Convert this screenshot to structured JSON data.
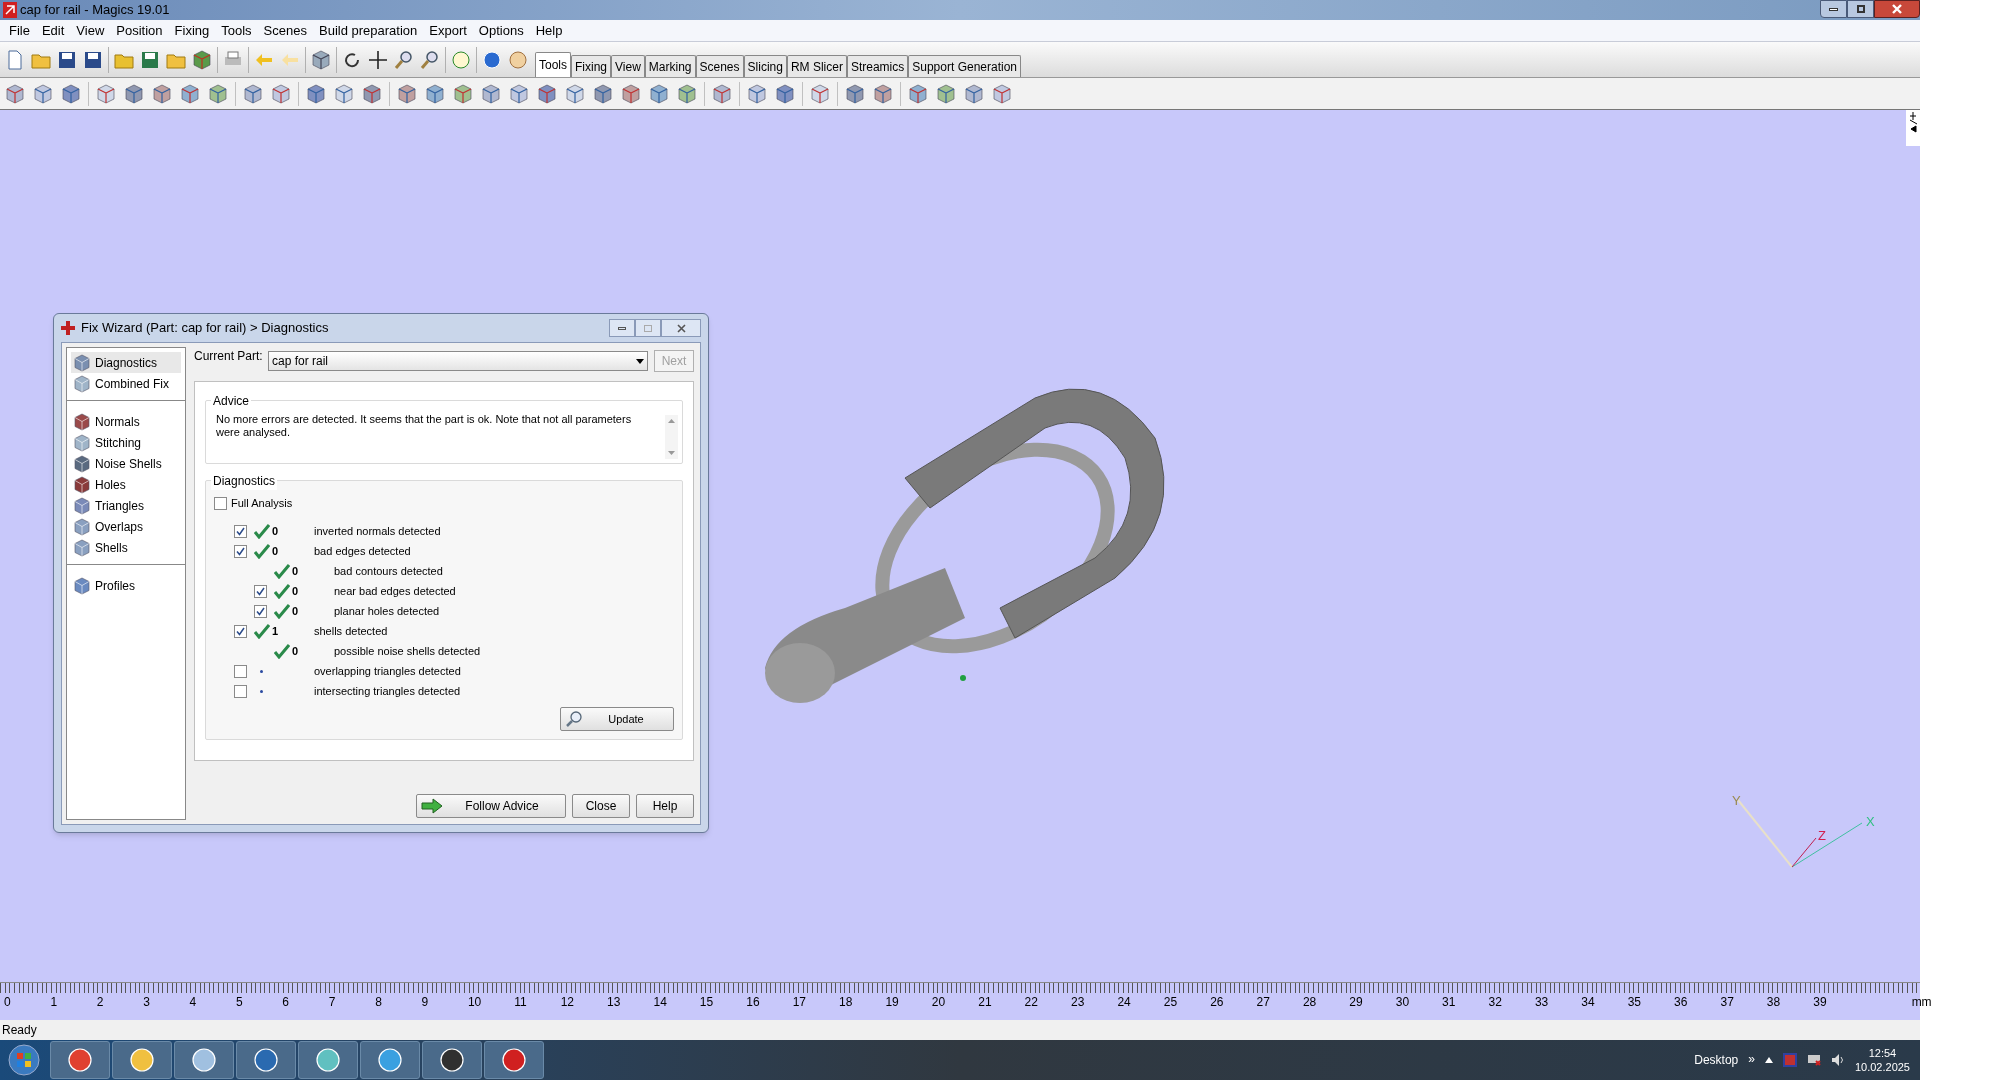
{
  "window": {
    "title": "cap for rail - Magics 19.01"
  },
  "menu": [
    "File",
    "Edit",
    "View",
    "Position",
    "Fixing",
    "Tools",
    "Scenes",
    "Build preparation",
    "Export",
    "Options",
    "Help"
  ],
  "toolbar_tabs": [
    {
      "label": "Tools",
      "selected": true
    },
    {
      "label": "Fixing",
      "selected": false
    },
    {
      "label": "View",
      "selected": false
    },
    {
      "label": "Marking",
      "selected": false
    },
    {
      "label": "Scenes",
      "selected": false
    },
    {
      "label": "Slicing",
      "selected": false
    },
    {
      "label": "RM Slicer",
      "selected": false
    },
    {
      "label": "Streamics",
      "selected": false
    },
    {
      "label": "Support Generation",
      "selected": false
    }
  ],
  "dialog": {
    "title": "Fix Wizard (Part: cap for rail) > Diagnostics",
    "nav_groups": [
      [
        {
          "label": "Diagnostics",
          "selected": true,
          "color": "#7a8fb0"
        },
        {
          "label": "Combined Fix",
          "selected": false,
          "color": "#9fb4c8"
        }
      ],
      [
        {
          "label": "Normals",
          "selected": false,
          "color": "#9a4a4a"
        },
        {
          "label": "Stitching",
          "selected": false,
          "color": "#9fb4c8"
        },
        {
          "label": "Noise Shells",
          "selected": false,
          "color": "#5a6a80"
        },
        {
          "label": "Holes",
          "selected": false,
          "color": "#8a3a3a"
        },
        {
          "label": "Triangles",
          "selected": false,
          "color": "#7a8ab8"
        },
        {
          "label": "Overlaps",
          "selected": false,
          "color": "#8aa0c0"
        },
        {
          "label": "Shells",
          "selected": false,
          "color": "#8aa0c0"
        }
      ],
      [
        {
          "label": "Profiles",
          "selected": false,
          "color": "#6a8ac0"
        }
      ]
    ],
    "current_part_label": "Current Part:",
    "current_part": "cap for rail",
    "next_button": {
      "label": "Next",
      "disabled": true
    },
    "advice": {
      "title": "Advice",
      "text": "No more errors are detected. It seems that the part is ok. Note that not all parameters were analysed."
    },
    "diagnostics": {
      "title": "Diagnostics",
      "full_analysis": {
        "label": "Full Analysis",
        "checked": false
      },
      "rows": [
        {
          "kind": "checkbox",
          "checked": true,
          "passed": true,
          "count": "0",
          "label": "inverted normals detected"
        },
        {
          "kind": "checkbox",
          "checked": true,
          "passed": true,
          "count": "0",
          "label": "bad edges detected",
          "children": [
            {
              "kind": "plain",
              "passed": true,
              "count": "0",
              "label": "bad contours detected"
            },
            {
              "kind": "checkbox",
              "checked": true,
              "passed": true,
              "count": "0",
              "label": "near bad edges detected"
            },
            {
              "kind": "checkbox",
              "checked": true,
              "passed": true,
              "count": "0",
              "label": "planar holes detected"
            }
          ]
        },
        {
          "kind": "checkbox",
          "checked": true,
          "passed": true,
          "count": "1",
          "label": "shells detected",
          "children": [
            {
              "kind": "plain",
              "passed": true,
              "count": "0",
              "label": "possible noise shells detected"
            }
          ]
        },
        {
          "kind": "checkbox",
          "checked": false,
          "passed": false,
          "label": "overlapping triangles detected"
        },
        {
          "kind": "checkbox",
          "checked": false,
          "passed": false,
          "label": "intersecting triangles detected"
        }
      ],
      "update_button": "Update"
    },
    "buttons": [
      {
        "kind": "follow",
        "label": "Follow Advice"
      },
      {
        "kind": "plain",
        "label": "Close"
      },
      {
        "kind": "plain",
        "label": "Help"
      }
    ]
  },
  "axes": {
    "y": "Y",
    "z": "Z",
    "x": "X"
  },
  "ruler": {
    "labels": [
      "0",
      "1",
      "2",
      "3",
      "4",
      "5",
      "6",
      "7",
      "8",
      "9",
      "10",
      "11",
      "12",
      "13",
      "14",
      "15",
      "16",
      "17",
      "18",
      "19",
      "20",
      "21",
      "22",
      "23",
      "24",
      "25",
      "26",
      "27",
      "28",
      "29",
      "30",
      "31",
      "32",
      "33",
      "34",
      "35",
      "36",
      "37",
      "38",
      "39"
    ],
    "unit": "mm"
  },
  "status_bar": "Ready",
  "taskbar": {
    "desktop": "Desktop",
    "chevron": "»",
    "time": "12:54",
    "date": "10.02.2025"
  }
}
